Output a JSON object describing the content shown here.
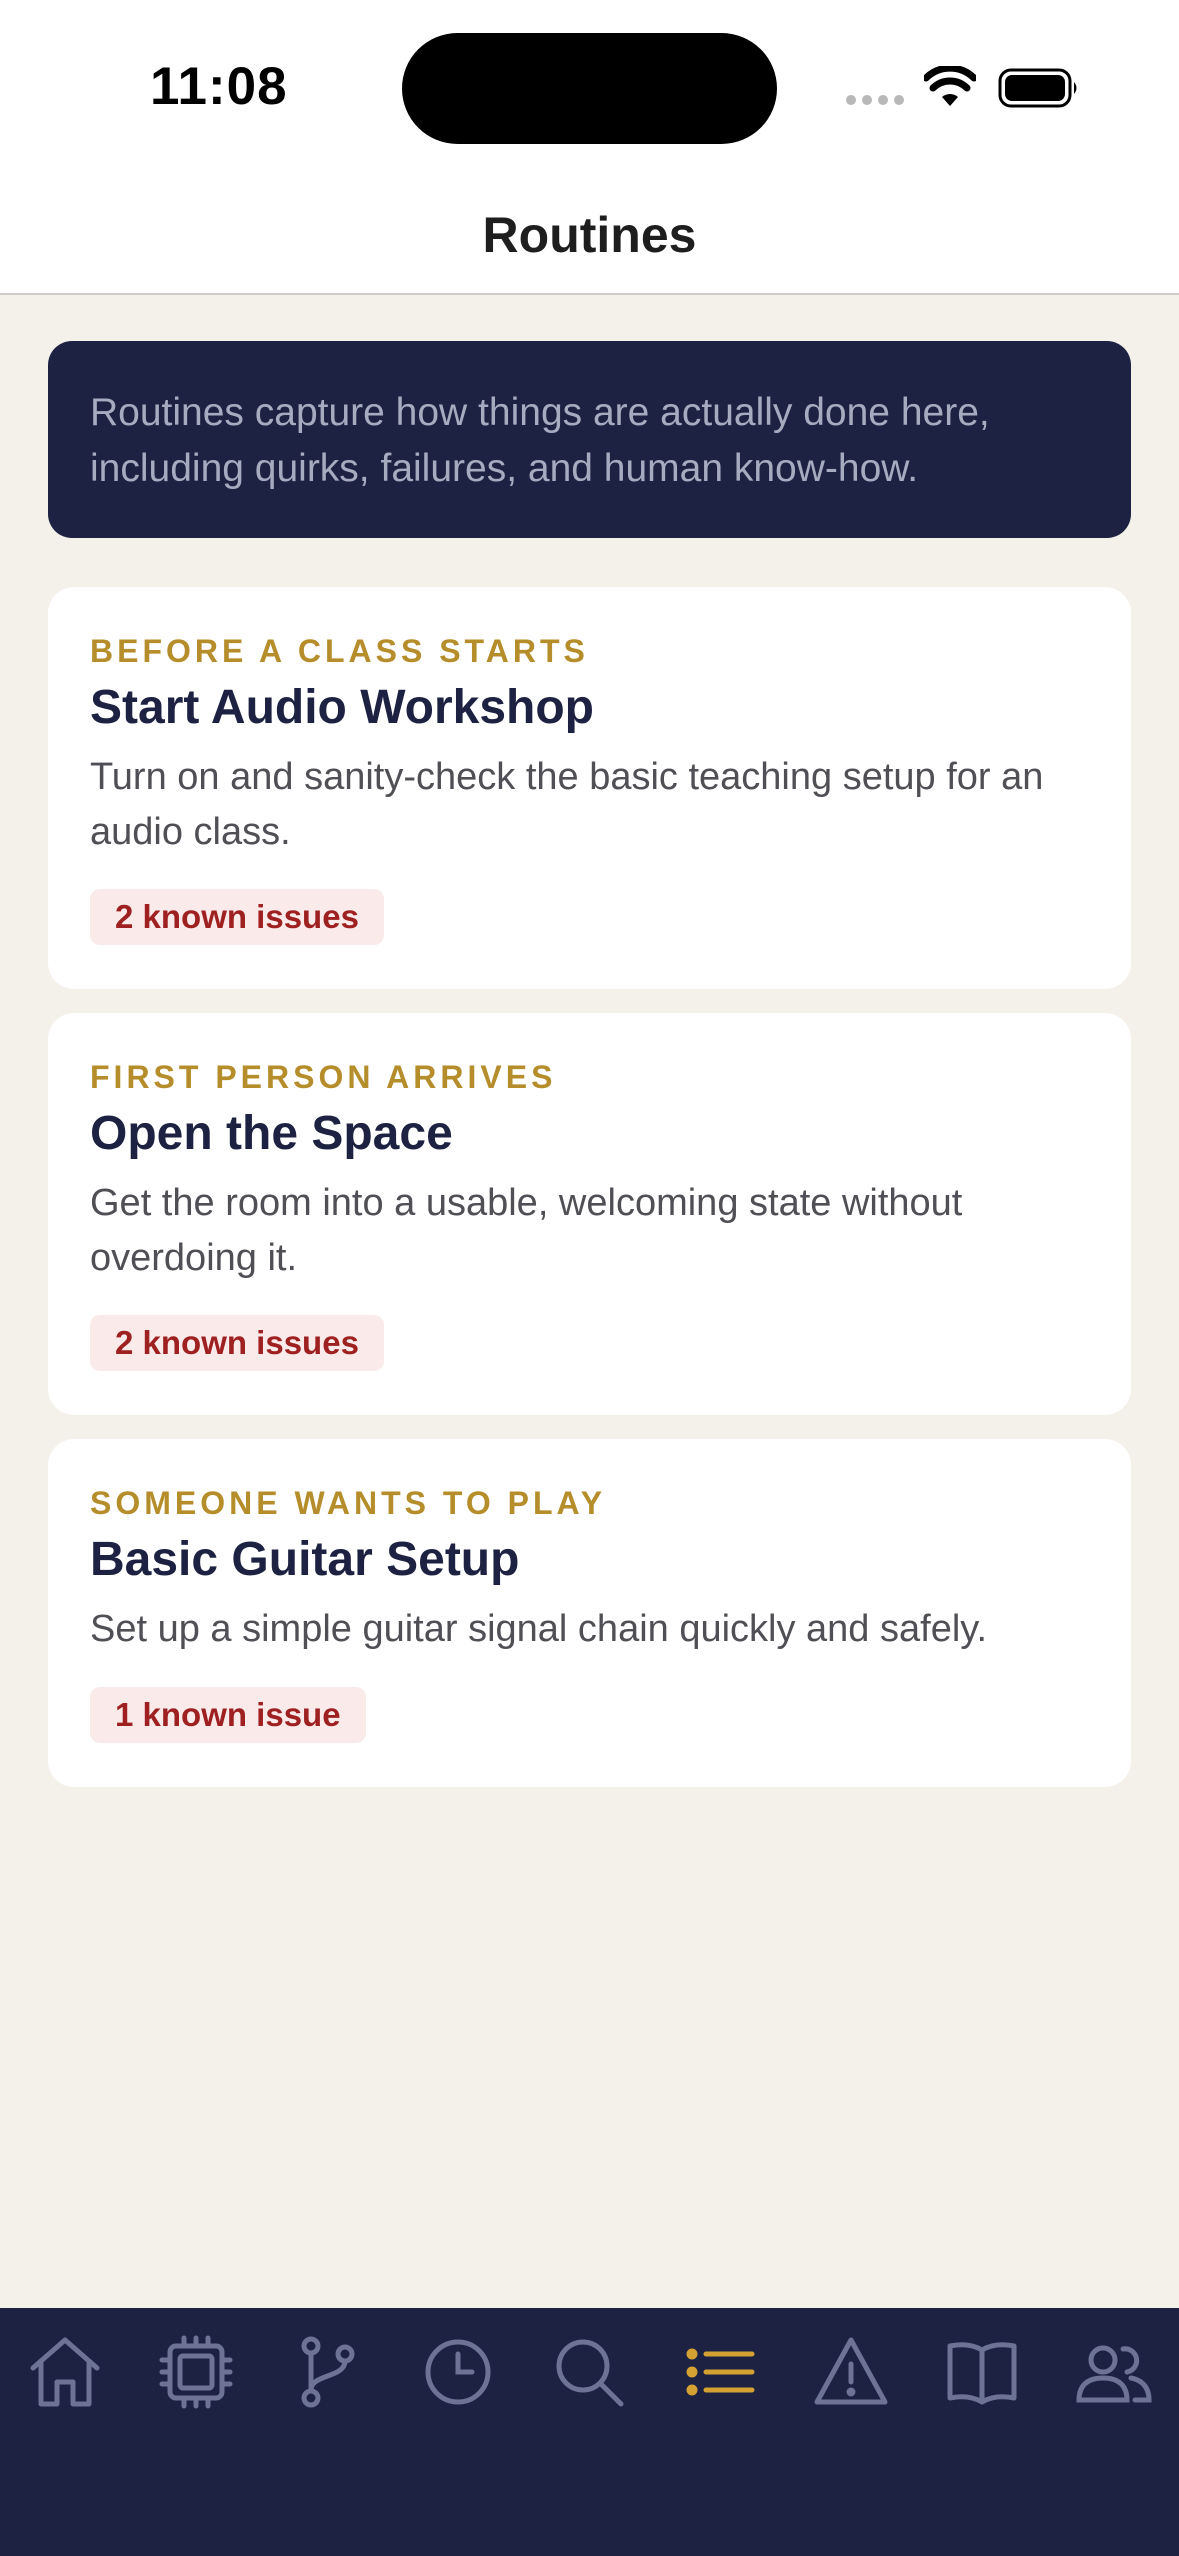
{
  "status_bar": {
    "time": "11:08"
  },
  "header": {
    "title": "Routines"
  },
  "intro": {
    "text": "Routines capture how things are actually done here, including quirks, failures, and human know-how."
  },
  "routines": [
    {
      "eyebrow": "BEFORE A CLASS STARTS",
      "title": "Start Audio Workshop",
      "description": "Turn on and sanity-check the basic teaching setup for an audio class.",
      "issues": "2 known issues"
    },
    {
      "eyebrow": "FIRST PERSON ARRIVES",
      "title": "Open the Space",
      "description": "Get the room into a usable, welcoming state without overdoing it.",
      "issues": "2 known issues"
    },
    {
      "eyebrow": "SOMEONE WANTS TO PLAY",
      "title": "Basic Guitar Setup",
      "description": "Set up a simple guitar signal chain quickly and safely.",
      "issues": "1 known issue"
    }
  ],
  "tab_bar": {
    "active_index": 5,
    "items": [
      {
        "icon": "home-icon"
      },
      {
        "icon": "chip-icon"
      },
      {
        "icon": "branch-icon"
      },
      {
        "icon": "clock-icon"
      },
      {
        "icon": "search-icon"
      },
      {
        "icon": "list-icon"
      },
      {
        "icon": "warning-icon"
      },
      {
        "icon": "book-icon"
      },
      {
        "icon": "people-icon"
      }
    ]
  },
  "colors": {
    "navy": "#1d2242",
    "gold_accent": "#b58d2a",
    "issue_red": "#9e2020",
    "issue_bg": "#fbeaea",
    "background": "#f4f0ea",
    "tab_inactive": "#6d7394"
  }
}
